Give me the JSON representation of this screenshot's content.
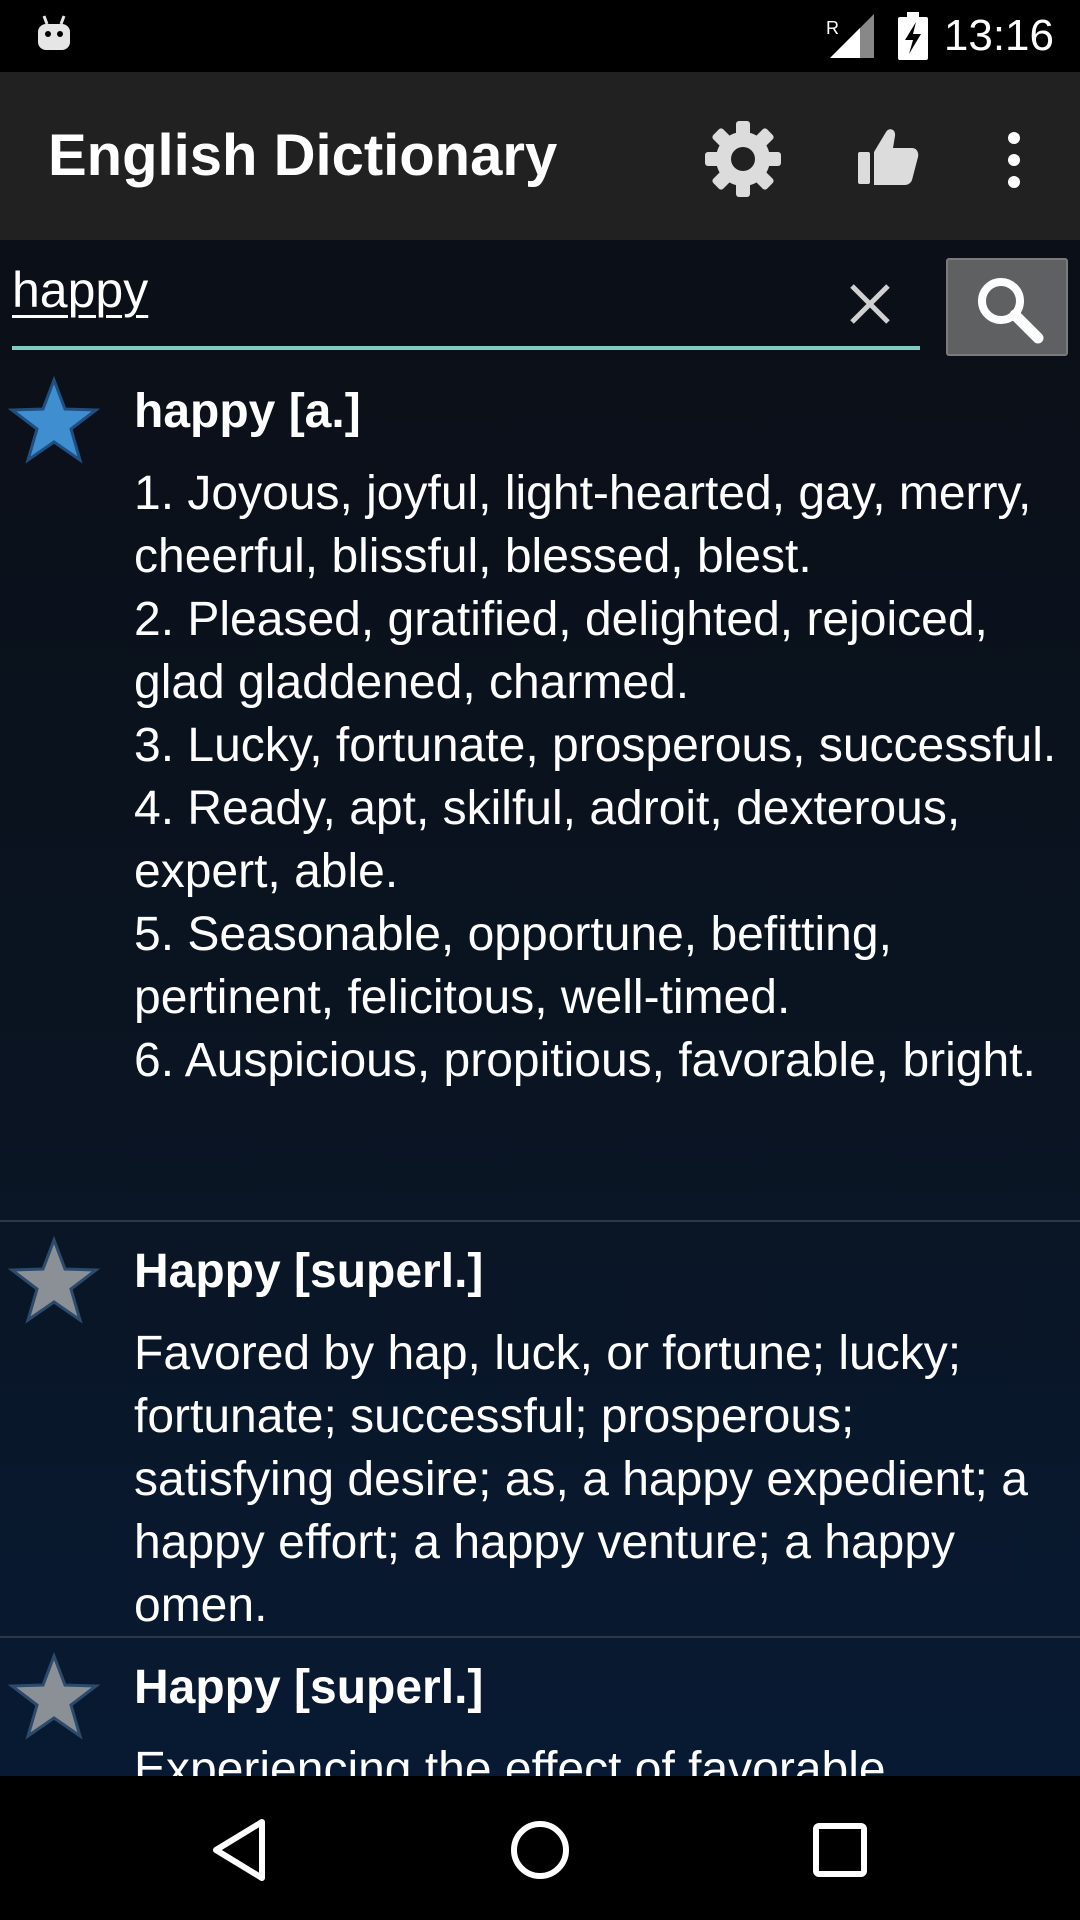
{
  "status_bar": {
    "time": "13:16",
    "signal_label": "R",
    "icons": [
      "android-icon",
      "signal-icon",
      "battery-charging-icon"
    ]
  },
  "app_bar": {
    "title": "English Dictionary",
    "icons": [
      "gear-icon",
      "thumbs-up-icon",
      "overflow-menu-icon"
    ]
  },
  "search": {
    "value": "happy",
    "clear_icon": "close-icon",
    "search_icon": "search-icon",
    "accent_color": "#80cbc4"
  },
  "entries": [
    {
      "headword": "happy [a.]",
      "starred": true,
      "star_color": "#3f8fd0",
      "definition": "1. Joyous, joyful, light-hearted, gay, merry, cheerful, blissful, blessed, blest.\n2. Pleased, gratified, delighted, rejoiced, glad gladdened, charmed.\n3. Lucky, fortunate, prosperous, successful.\n4. Ready, apt, skilful, adroit, dexterous, expert, able.\n5. Seasonable, opportune, befitting, pertinent, felicitous, well-timed.\n6. Auspicious, propitious, favorable, bright."
    },
    {
      "headword": "Happy [superl.]",
      "starred": false,
      "star_color": "#8b8f96",
      "definition": "Favored by hap, luck, or fortune; lucky; fortunate; successful; prosperous; satisfying desire; as, a happy expedient; a happy effort; a happy venture; a happy omen."
    },
    {
      "headword": "Happy [superl.]",
      "starred": false,
      "star_color": "#8b8f96",
      "definition": "Experiencing the effect of favorable"
    }
  ],
  "nav_bar": {
    "icons": [
      "back-icon",
      "home-icon",
      "recents-icon"
    ]
  }
}
